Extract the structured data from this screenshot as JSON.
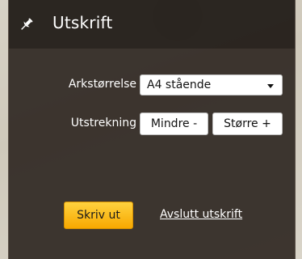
{
  "panel": {
    "title": "Utskrift",
    "pin_icon": "pin-icon"
  },
  "form": {
    "paper_size_label": "Arkstørrelse",
    "paper_size_value": "A4 stående",
    "extent_label": "Utstrekning",
    "smaller_label": "Mindre -",
    "bigger_label": "Større +"
  },
  "actions": {
    "print_label": "Skriv ut",
    "exit_label": "Avslutt utskrift"
  },
  "colors": {
    "panel_bg": "#302924",
    "print_button": "#f7a800"
  }
}
